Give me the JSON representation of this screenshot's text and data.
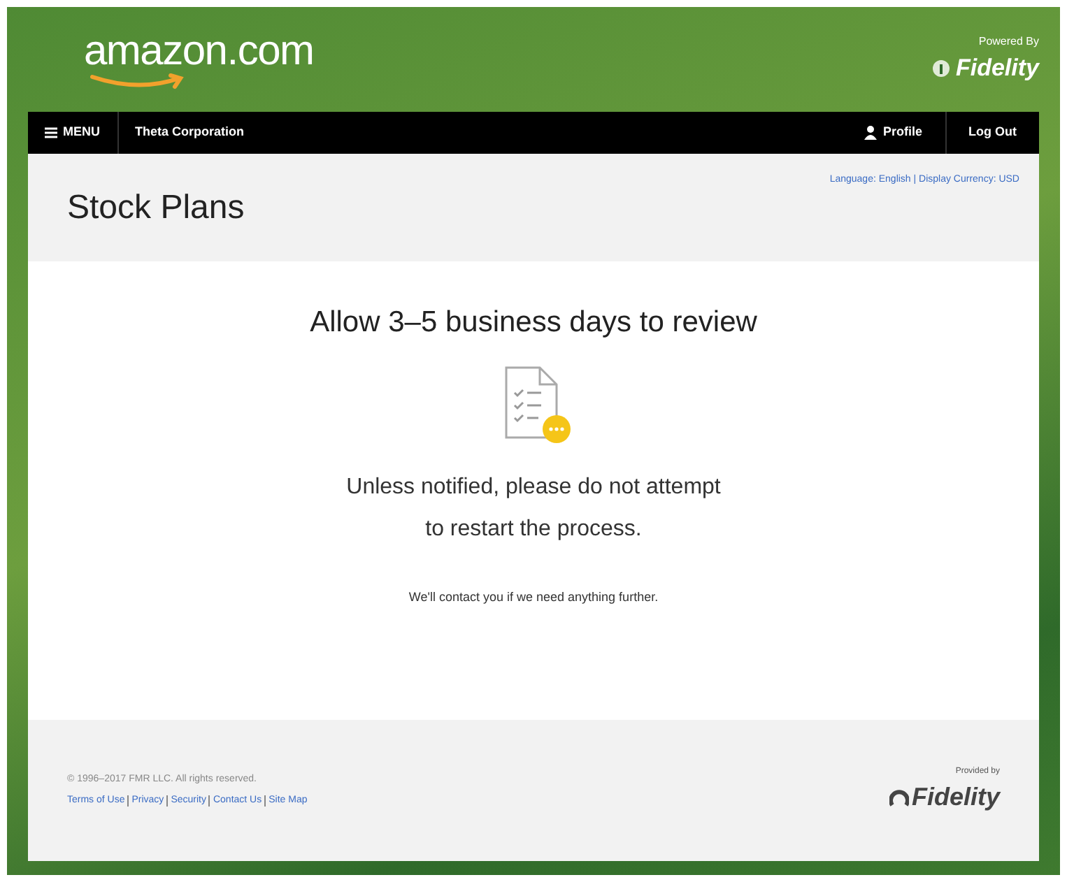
{
  "header": {
    "logo": "amazon.com",
    "powered_by": "Powered By",
    "partner": "Fidelity"
  },
  "nav": {
    "menu": "MENU",
    "company": "Theta Corporation",
    "profile": "Profile",
    "logout": "Log Out"
  },
  "title_bar": {
    "title": "Stock Plans",
    "language": "Language: English | Display Currency: USD"
  },
  "content": {
    "heading": "Allow 3–5 business days to review",
    "message_lines": [
      "Unless notified, please do not attempt",
      "to restart the process."
    ],
    "note": "We'll contact you if we need anything further."
  },
  "footer": {
    "copyright": "© 1996–2017 FMR LLC. All rights reserved.",
    "links": [
      "Terms of Use",
      "Privacy",
      "Security",
      "Contact Us",
      "Site Map"
    ],
    "provided_by": "Provided by",
    "partner": "Fidelity"
  }
}
